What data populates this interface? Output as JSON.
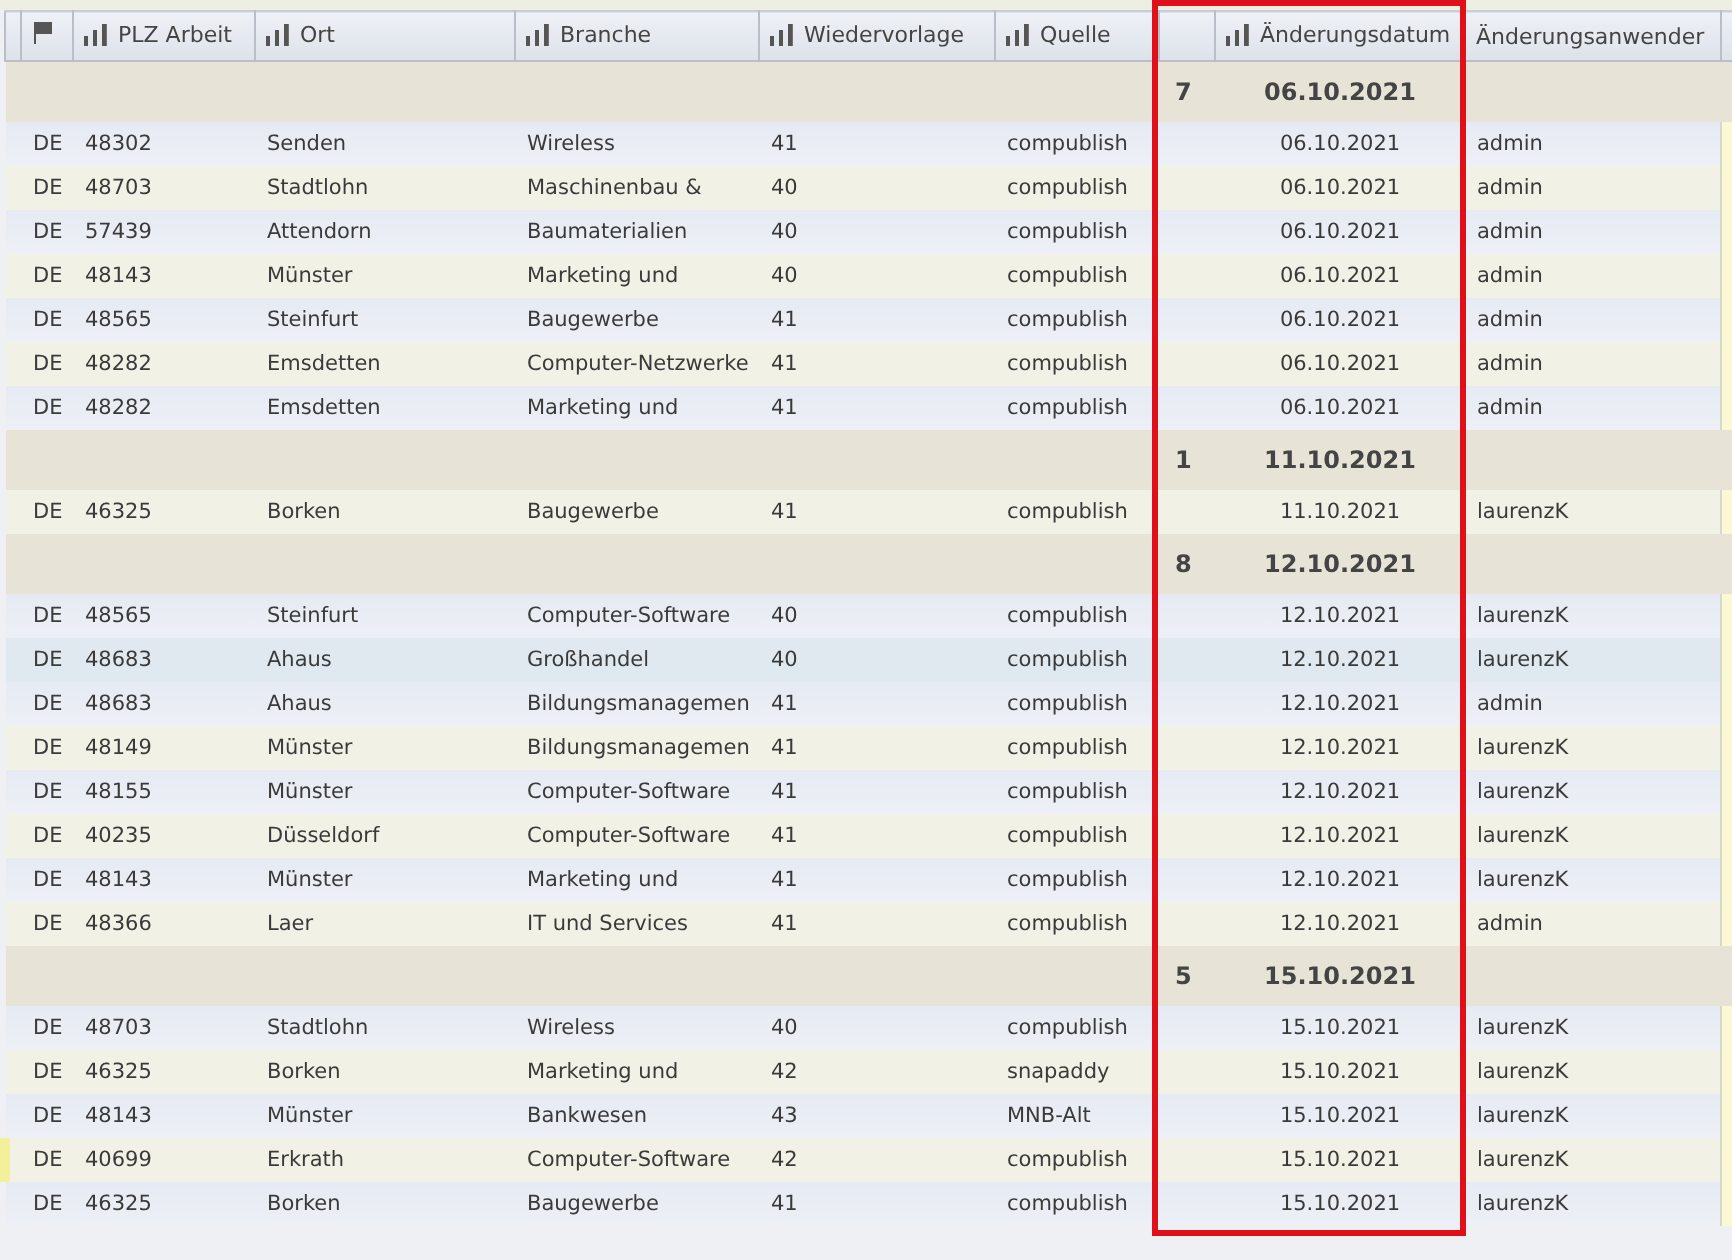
{
  "columns": [
    {
      "kind": "blank"
    },
    {
      "kind": "flag"
    },
    {
      "label": "PLZ Arbeit",
      "kind": "sort"
    },
    {
      "label": "Ort",
      "kind": "sort"
    },
    {
      "label": "Branche",
      "kind": "sort"
    },
    {
      "label": "Wiedervorlage",
      "kind": "sort"
    },
    {
      "label": "Quelle",
      "kind": "sort"
    },
    {
      "kind": "blank"
    },
    {
      "label": "Änderungsdatum",
      "kind": "sort"
    },
    {
      "label": "Änderungsanwender",
      "kind": "plain"
    }
  ],
  "groups": [
    {
      "count": "7",
      "date": "06.10.2021",
      "rows": [
        {
          "country": "DE",
          "plz": "48302",
          "ort": "Senden",
          "branche": "Wireless",
          "wiedervorlage": "41",
          "quelle": "compublish",
          "datum": "06.10.2021",
          "anwender": "admin",
          "marked": false,
          "selected": false
        },
        {
          "country": "DE",
          "plz": "48703",
          "ort": "Stadtlohn",
          "branche": "Maschinenbau &",
          "wiedervorlage": "40",
          "quelle": "compublish",
          "datum": "06.10.2021",
          "anwender": "admin",
          "marked": false,
          "selected": false
        },
        {
          "country": "DE",
          "plz": "57439",
          "ort": "Attendorn",
          "branche": "Baumaterialien",
          "wiedervorlage": "40",
          "quelle": "compublish",
          "datum": "06.10.2021",
          "anwender": "admin",
          "marked": false,
          "selected": false
        },
        {
          "country": "DE",
          "plz": "48143",
          "ort": "Münster",
          "branche": "Marketing und",
          "wiedervorlage": "40",
          "quelle": "compublish",
          "datum": "06.10.2021",
          "anwender": "admin",
          "marked": false,
          "selected": false
        },
        {
          "country": "DE",
          "plz": "48565",
          "ort": "Steinfurt",
          "branche": "Baugewerbe",
          "wiedervorlage": "41",
          "quelle": "compublish",
          "datum": "06.10.2021",
          "anwender": "admin",
          "marked": false,
          "selected": false
        },
        {
          "country": "DE",
          "plz": "48282",
          "ort": "Emsdetten",
          "branche": "Computer-Netzwerke",
          "wiedervorlage": "41",
          "quelle": "compublish",
          "datum": "06.10.2021",
          "anwender": "admin",
          "marked": false,
          "selected": false
        },
        {
          "country": "DE",
          "plz": "48282",
          "ort": "Emsdetten",
          "branche": "Marketing und",
          "wiedervorlage": "41",
          "quelle": "compublish",
          "datum": "06.10.2021",
          "anwender": "admin",
          "marked": false,
          "selected": false
        }
      ]
    },
    {
      "count": "1",
      "date": "11.10.2021",
      "rows": [
        {
          "country": "DE",
          "plz": "46325",
          "ort": "Borken",
          "branche": "Baugewerbe",
          "wiedervorlage": "41",
          "quelle": "compublish",
          "datum": "11.10.2021",
          "anwender": "laurenzK",
          "marked": false,
          "selected": false
        }
      ]
    },
    {
      "count": "8",
      "date": "12.10.2021",
      "rows": [
        {
          "country": "DE",
          "plz": "48565",
          "ort": "Steinfurt",
          "branche": "Computer-Software",
          "wiedervorlage": "40",
          "quelle": "compublish",
          "datum": "12.10.2021",
          "anwender": "laurenzK",
          "marked": false,
          "selected": false
        },
        {
          "country": "DE",
          "plz": "48683",
          "ort": "Ahaus",
          "branche": "Großhandel",
          "wiedervorlage": "40",
          "quelle": "compublish",
          "datum": "12.10.2021",
          "anwender": "laurenzK",
          "marked": false,
          "selected": true
        },
        {
          "country": "DE",
          "plz": "48683",
          "ort": "Ahaus",
          "branche": "Bildungsmanagemen",
          "wiedervorlage": "41",
          "quelle": "compublish",
          "datum": "12.10.2021",
          "anwender": "admin",
          "marked": false,
          "selected": false
        },
        {
          "country": "DE",
          "plz": "48149",
          "ort": "Münster",
          "branche": "Bildungsmanagemen",
          "wiedervorlage": "41",
          "quelle": "compublish",
          "datum": "12.10.2021",
          "anwender": "laurenzK",
          "marked": false,
          "selected": false
        },
        {
          "country": "DE",
          "plz": "48155",
          "ort": "Münster",
          "branche": "Computer-Software",
          "wiedervorlage": "41",
          "quelle": "compublish",
          "datum": "12.10.2021",
          "anwender": "laurenzK",
          "marked": false,
          "selected": false
        },
        {
          "country": "DE",
          "plz": "40235",
          "ort": "Düsseldorf",
          "branche": "Computer-Software",
          "wiedervorlage": "41",
          "quelle": "compublish",
          "datum": "12.10.2021",
          "anwender": "laurenzK",
          "marked": false,
          "selected": false
        },
        {
          "country": "DE",
          "plz": "48143",
          "ort": "Münster",
          "branche": "Marketing und",
          "wiedervorlage": "41",
          "quelle": "compublish",
          "datum": "12.10.2021",
          "anwender": "laurenzK",
          "marked": false,
          "selected": false
        },
        {
          "country": "DE",
          "plz": "48366",
          "ort": "Laer",
          "branche": "IT und Services",
          "wiedervorlage": "41",
          "quelle": "compublish",
          "datum": "12.10.2021",
          "anwender": "admin",
          "marked": false,
          "selected": false
        }
      ]
    },
    {
      "count": "5",
      "date": "15.10.2021",
      "rows": [
        {
          "country": "DE",
          "plz": "48703",
          "ort": "Stadtlohn",
          "branche": "Wireless",
          "wiedervorlage": "40",
          "quelle": "compublish",
          "datum": "15.10.2021",
          "anwender": "laurenzK",
          "marked": false,
          "selected": false
        },
        {
          "country": "DE",
          "plz": "46325",
          "ort": "Borken",
          "branche": "Marketing und",
          "wiedervorlage": "42",
          "quelle": "snapaddy",
          "datum": "15.10.2021",
          "anwender": "laurenzK",
          "marked": false,
          "selected": false
        },
        {
          "country": "DE",
          "plz": "48143",
          "ort": "Münster",
          "branche": "Bankwesen",
          "wiedervorlage": "43",
          "quelle": "MNB-Alt",
          "datum": "15.10.2021",
          "anwender": "laurenzK",
          "marked": false,
          "selected": false
        },
        {
          "country": "DE",
          "plz": "40699",
          "ort": "Erkrath",
          "branche": "Computer-Software",
          "wiedervorlage": "42",
          "quelle": "compublish",
          "datum": "15.10.2021",
          "anwender": "laurenzK",
          "marked": true,
          "selected": false
        },
        {
          "country": "DE",
          "plz": "46325",
          "ort": "Borken",
          "branche": "Baugewerbe",
          "wiedervorlage": "41",
          "quelle": "compublish",
          "datum": "15.10.2021",
          "anwender": "laurenzK",
          "marked": false,
          "selected": false
        }
      ]
    }
  ]
}
